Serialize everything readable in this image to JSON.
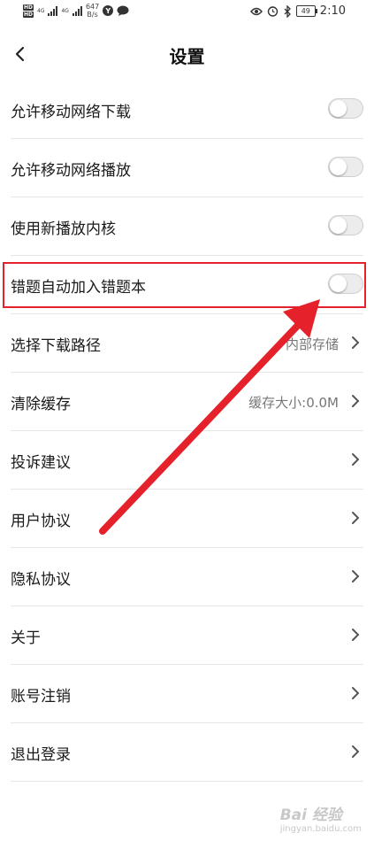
{
  "status_bar": {
    "hd1": "HD",
    "hd2": "HD",
    "net1": "4G",
    "net2": "4G",
    "speed_value": "647",
    "speed_unit": "B/s",
    "badge": "Y",
    "battery": "49",
    "time": "2:10"
  },
  "header": {
    "title": "设置"
  },
  "rows": [
    {
      "label": "允许移动网络下载"
    },
    {
      "label": "允许移动网络播放"
    },
    {
      "label": "使用新播放内核"
    },
    {
      "label": "错题自动加入错题本"
    },
    {
      "label": "选择下载路径",
      "value": "内部存储"
    },
    {
      "label": "清除缓存",
      "value": "缓存大小:0.0M"
    },
    {
      "label": "投诉建议"
    },
    {
      "label": "用户协议"
    },
    {
      "label": "隐私协议"
    },
    {
      "label": "关于"
    },
    {
      "label": "账号注销"
    },
    {
      "label": "退出登录"
    }
  ],
  "toggles_on": [
    false,
    false,
    false,
    false
  ],
  "annotation": {
    "color": "#e5222b"
  },
  "watermark": {
    "brand": "Bai 经验",
    "url": "jingyan.baidu.com"
  }
}
